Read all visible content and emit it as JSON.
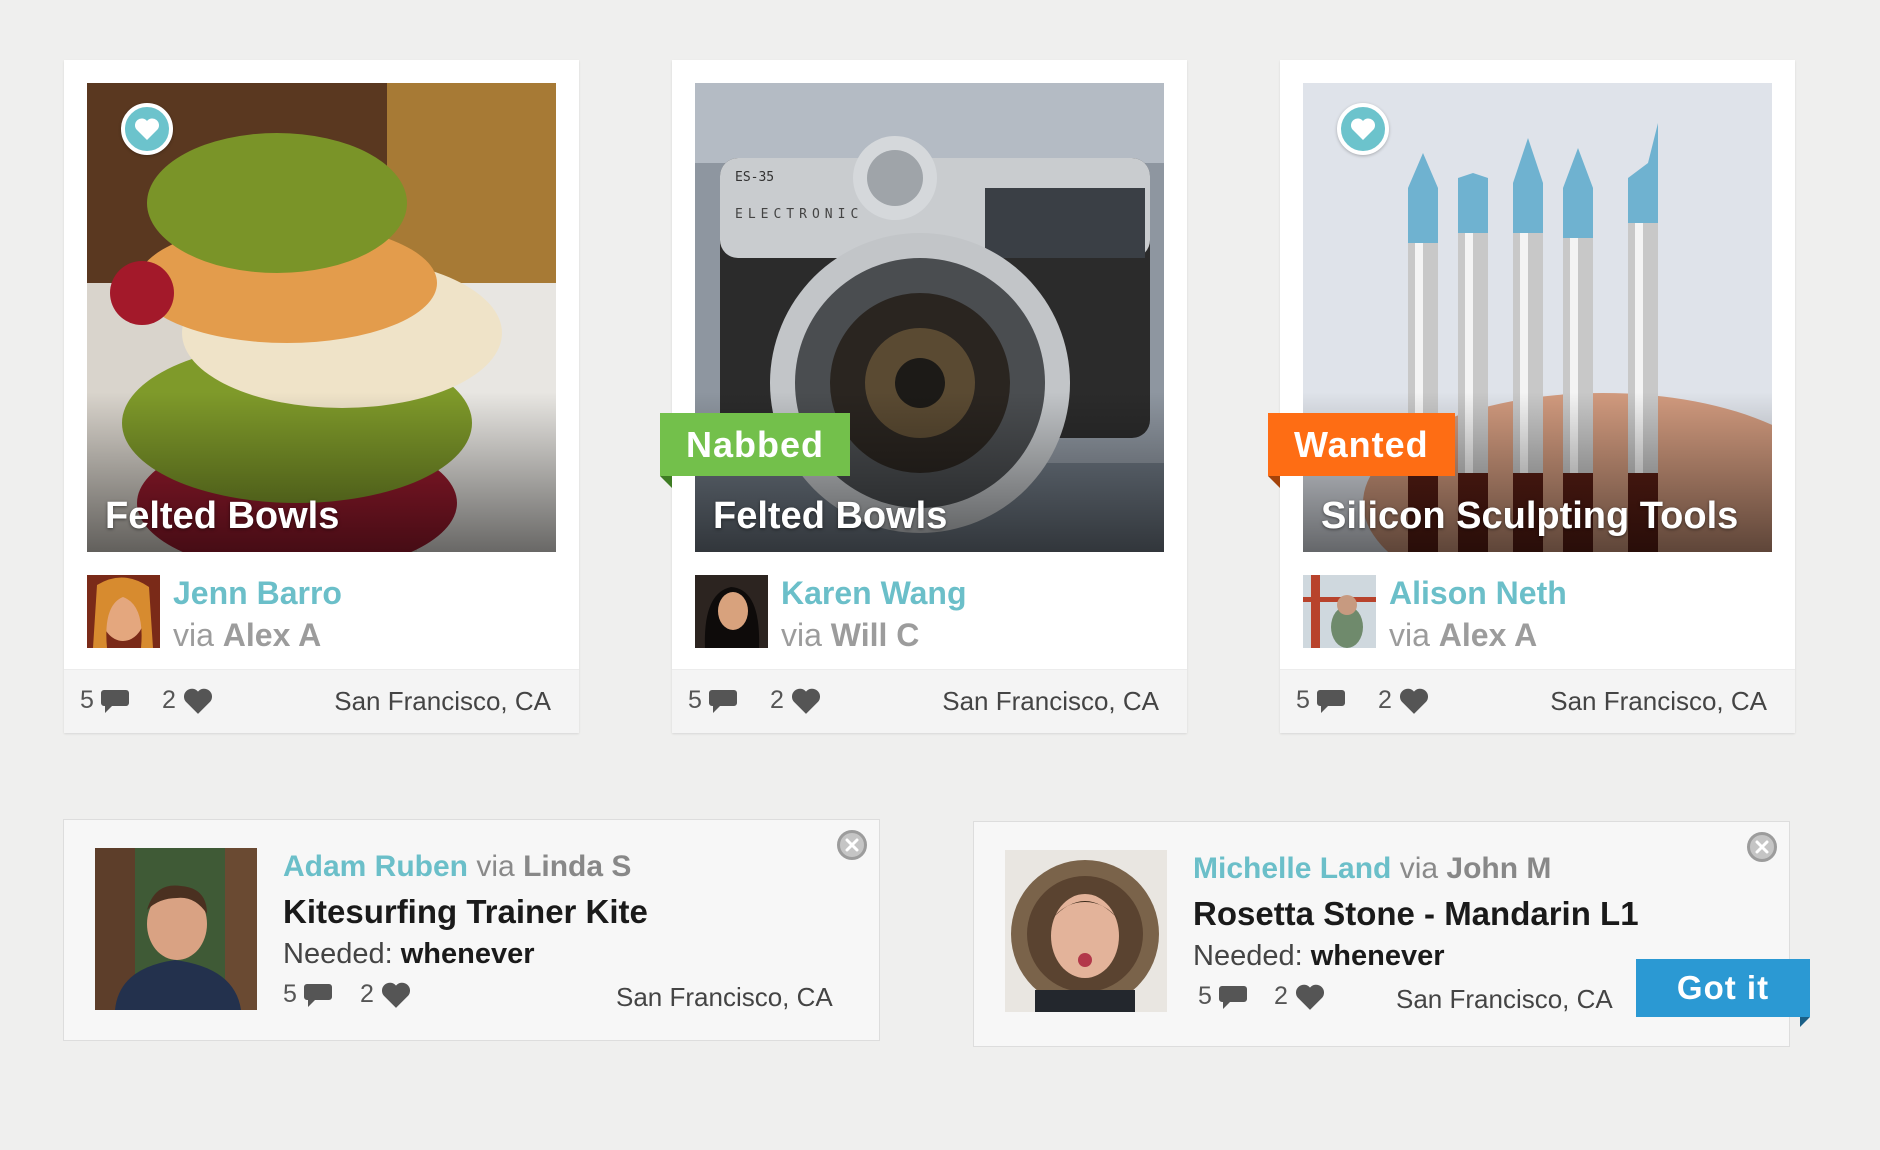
{
  "colors": {
    "background": "#efefee",
    "accent_teal": "#6bbfc9",
    "nabbed_green": "#73c04b",
    "wanted_orange": "#fe6d14",
    "got_it_blue": "#2b99d3"
  },
  "cards": [
    {
      "title": "Felted Bowls",
      "favorite_icon": "heart-icon",
      "tag": "",
      "user": "Jenn Barro",
      "via_prefix": "via",
      "via_name": "Alex A",
      "comments": "5",
      "likes": "2",
      "location": "San Francisco, CA"
    },
    {
      "title": "Felted Bowls",
      "tag": "Nabbed",
      "user": "Karen Wang",
      "via_prefix": "via",
      "via_name": "Will C",
      "comments": "5",
      "likes": "2",
      "location": "San Francisco, CA"
    },
    {
      "title": "Silicon Sculpting Tools",
      "favorite_icon": "heart-icon",
      "tag": "Wanted",
      "user": "Alison Neth",
      "via_prefix": "via",
      "via_name": "Alex A",
      "comments": "5",
      "likes": "2",
      "location": "San Francisco, CA"
    }
  ],
  "requests": [
    {
      "user": "Adam Ruben",
      "via_prefix": "via",
      "via_name": "Linda S",
      "item": "Kitesurfing Trainer Kite",
      "needed_label": "Needed:",
      "needed_value": "whenever",
      "comments": "5",
      "likes": "2",
      "location": "San Francisco, CA"
    },
    {
      "user": "Michelle Land",
      "via_prefix": "via",
      "via_name": "John M",
      "item": "Rosetta Stone - Mandarin L1",
      "needed_label": "Needed:",
      "needed_value": "whenever",
      "comments": "5",
      "likes": "2",
      "location": "San Francisco, CA",
      "action_label": "Got it"
    }
  ]
}
